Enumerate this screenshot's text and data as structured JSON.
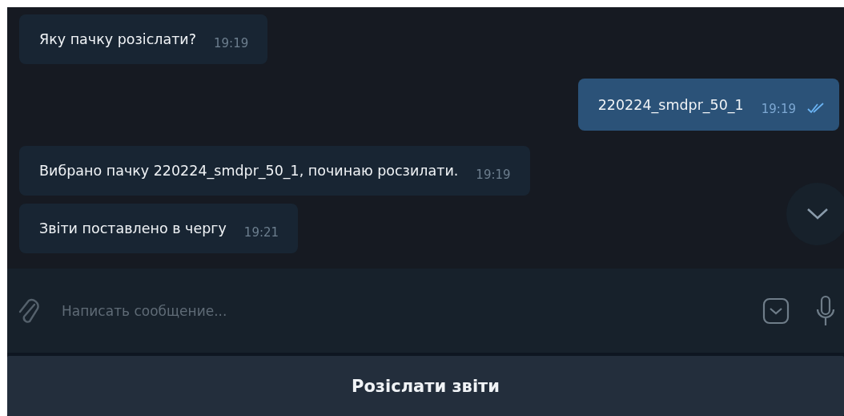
{
  "messages": [
    {
      "text": "Яку пачку розіслати?",
      "time": "19:19",
      "outgoing": false
    },
    {
      "text": "220224_smdpr_50_1",
      "time": "19:19",
      "outgoing": true,
      "read": true
    },
    {
      "text": "Вибрано пачку 220224_smdpr_50_1, починаю росзилати.",
      "time": "19:19",
      "outgoing": false
    },
    {
      "text": "Звіти поставлено в чергу",
      "time": "19:21",
      "outgoing": false
    }
  ],
  "composer": {
    "placeholder": "Написать сообщение..."
  },
  "keyboard_buttons": [
    "Розіслати звіти"
  ]
}
